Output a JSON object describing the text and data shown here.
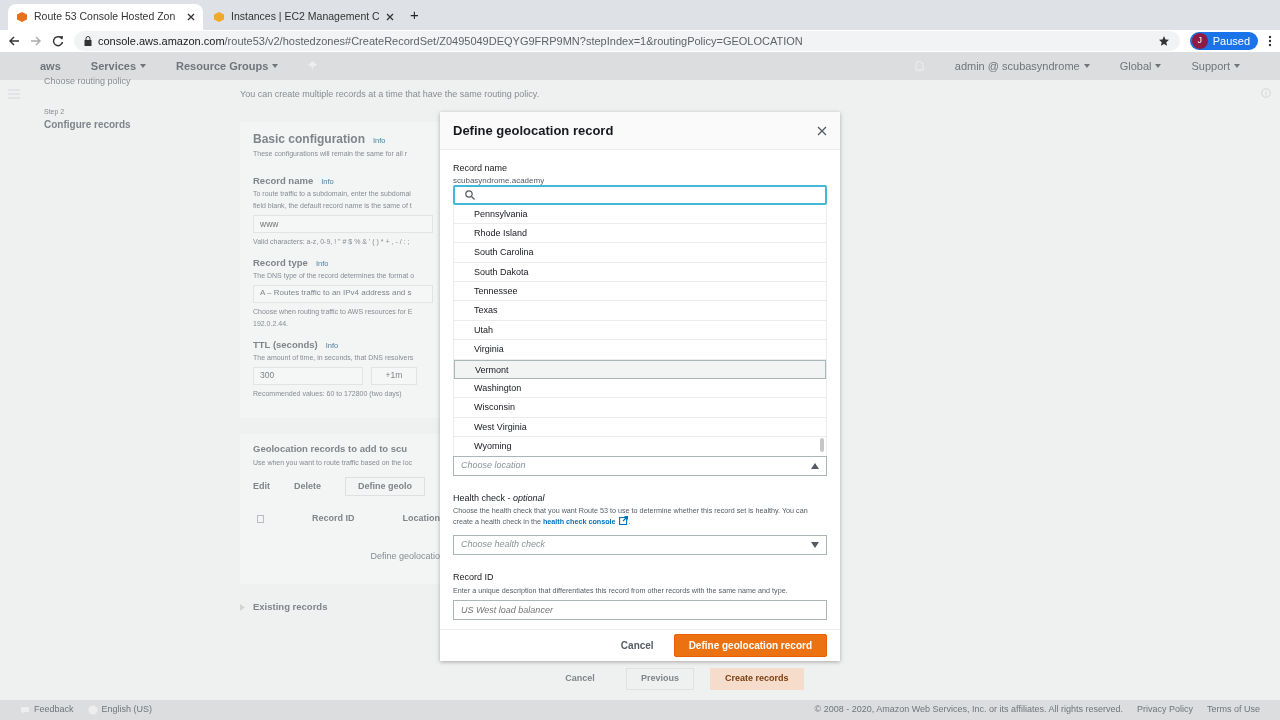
{
  "browser": {
    "tabs": [
      {
        "title": "Route 53 Console Hosted Zon",
        "selected": true
      },
      {
        "title": "Instances | EC2 Management C",
        "selected": false
      }
    ],
    "new_tab": "+",
    "url_host": "console.aws.amazon.com",
    "url_path": "/route53/v2/hostedzones#CreateRecordSet/Z0495049DEQYG9FRP9MN?stepIndex=1&routingPolicy=GEOLOCATION",
    "profile": {
      "initial": "J",
      "label": "Paused"
    }
  },
  "aws_nav": {
    "logo": "aws",
    "menus": [
      "Services",
      "Resource Groups"
    ],
    "account": "admin @ scubasyndrome",
    "region": "Global",
    "support": "Support"
  },
  "sidebar": {
    "prev_step": "Choose routing policy",
    "step_label": "Step 2",
    "step_title": "Configure records"
  },
  "page": {
    "intro": "You can create multiple records at a time that have the same routing policy.",
    "basic": {
      "title": "Basic configuration",
      "info": "Info",
      "description": "These configurations will remain the same for all r",
      "fields": [
        {
          "kind": "input",
          "label": "Record name",
          "info": "Info",
          "description": [
            "To route traffic to a subdomain, enter the subdomai",
            "field blank, the default record name is the same of t"
          ],
          "placeholder": "www",
          "hint": [
            "Valid characters: a-z, 0-9, ! \" # $ % & ' ( ) * + , - / : ;"
          ]
        },
        {
          "kind": "select",
          "label": "Record type",
          "info": "Info",
          "description": [
            "The DNS type of the record determines the format o"
          ],
          "value": "A – Routes traffic to an IPv4 address and s",
          "hint": [
            "Choose when routing traffic to AWS resources for E",
            "192.0.2.44."
          ]
        },
        {
          "kind": "ttl",
          "label": "TTL (seconds)",
          "info": "Info",
          "description": [
            "The amount of time, in seconds, that DNS resolvers"
          ],
          "value": "300",
          "button": "+1m",
          "hint": [
            "Recommended values: 60 to 172800 (two days)"
          ]
        }
      ]
    },
    "geo": {
      "title": "Geolocation records to add to scu",
      "description": "Use when you want to route traffic based on the loc",
      "buttons": [
        {
          "label": "Edit",
          "kind": "plain"
        },
        {
          "label": "Delete",
          "kind": "plain"
        },
        {
          "label": "Define geolo",
          "kind": "outline"
        }
      ],
      "select_all_checked": false,
      "columns": [
        "Record ID",
        "Location"
      ],
      "empty": "Define geolocatio"
    },
    "existing": "Existing records",
    "actions": [
      {
        "label": "Cancel",
        "kind": "plain"
      },
      {
        "label": "Previous",
        "kind": "outline"
      },
      {
        "label": "Create records",
        "kind": "primary"
      }
    ]
  },
  "modal": {
    "title": "Define geolocation record",
    "record_name_label": "Record name",
    "record_name_value": "scubasyndrome.academy",
    "options": [
      {
        "label": "Pennsylvania",
        "selected": false
      },
      {
        "label": "Rhode Island",
        "selected": false
      },
      {
        "label": "South Carolina",
        "selected": false
      },
      {
        "label": "South Dakota",
        "selected": false
      },
      {
        "label": "Tennessee",
        "selected": false
      },
      {
        "label": "Texas",
        "selected": false
      },
      {
        "label": "Utah",
        "selected": false
      },
      {
        "label": "Virginia",
        "selected": false
      },
      {
        "label": "Vermont",
        "selected": true
      },
      {
        "label": "Washington",
        "selected": false
      },
      {
        "label": "Wisconsin",
        "selected": false
      },
      {
        "label": "West Virginia",
        "selected": false
      },
      {
        "label": "Wyoming",
        "selected": false
      }
    ],
    "location_placeholder": "Choose location",
    "health": {
      "label": "Health check - *optional*",
      "description": "Choose the health check that you want Route 53 to use to determine whether this record set is healthy. You can create a health check in the ",
      "link": "health check console",
      "after": ".",
      "placeholder": "Choose health check"
    },
    "record_id": {
      "label": "Record ID",
      "description": "Enter a unique description that differentiates this record from other records with the same name and type.",
      "placeholder": "US West load balancer"
    },
    "cancel": "Cancel",
    "submit": "Define geolocation record"
  },
  "footer": {
    "feedback": "Feedback",
    "language": "English (US)",
    "copyright": "© 2008 - 2020, Amazon Web Services, Inc. or its affiliates. All rights reserved.",
    "privacy": "Privacy Policy",
    "terms": "Terms of Use"
  }
}
